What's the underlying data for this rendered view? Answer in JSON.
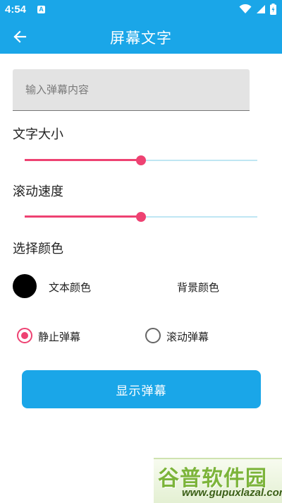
{
  "status_bar": {
    "time": "4:54",
    "notification_icon_letter": "A"
  },
  "app_bar": {
    "title": "屏幕文字",
    "back_icon": "arrow-left-icon"
  },
  "danmaku_input": {
    "placeholder": "输入弹幕内容",
    "value": ""
  },
  "font_size": {
    "label": "文字大小",
    "level": 0.5
  },
  "scroll_speed": {
    "label": "滚动速度",
    "level": 0.5
  },
  "color_picker": {
    "label": "选择颜色",
    "swatch_color": "#000000",
    "text_color_label": "文本颜色",
    "background_color_label": "背景颜色"
  },
  "mode": {
    "options": [
      {
        "label": "静止弹幕",
        "selected": true
      },
      {
        "label": "滚动弹幕",
        "selected": false
      }
    ]
  },
  "show_button": {
    "label": "显示弹幕"
  },
  "colors": {
    "primary": "#1aa6e8",
    "accent": "#ee4272",
    "track": "#bfe6f3"
  },
  "watermark": {
    "title": "谷普软件园",
    "url": "www.gupuxlazal.com"
  }
}
